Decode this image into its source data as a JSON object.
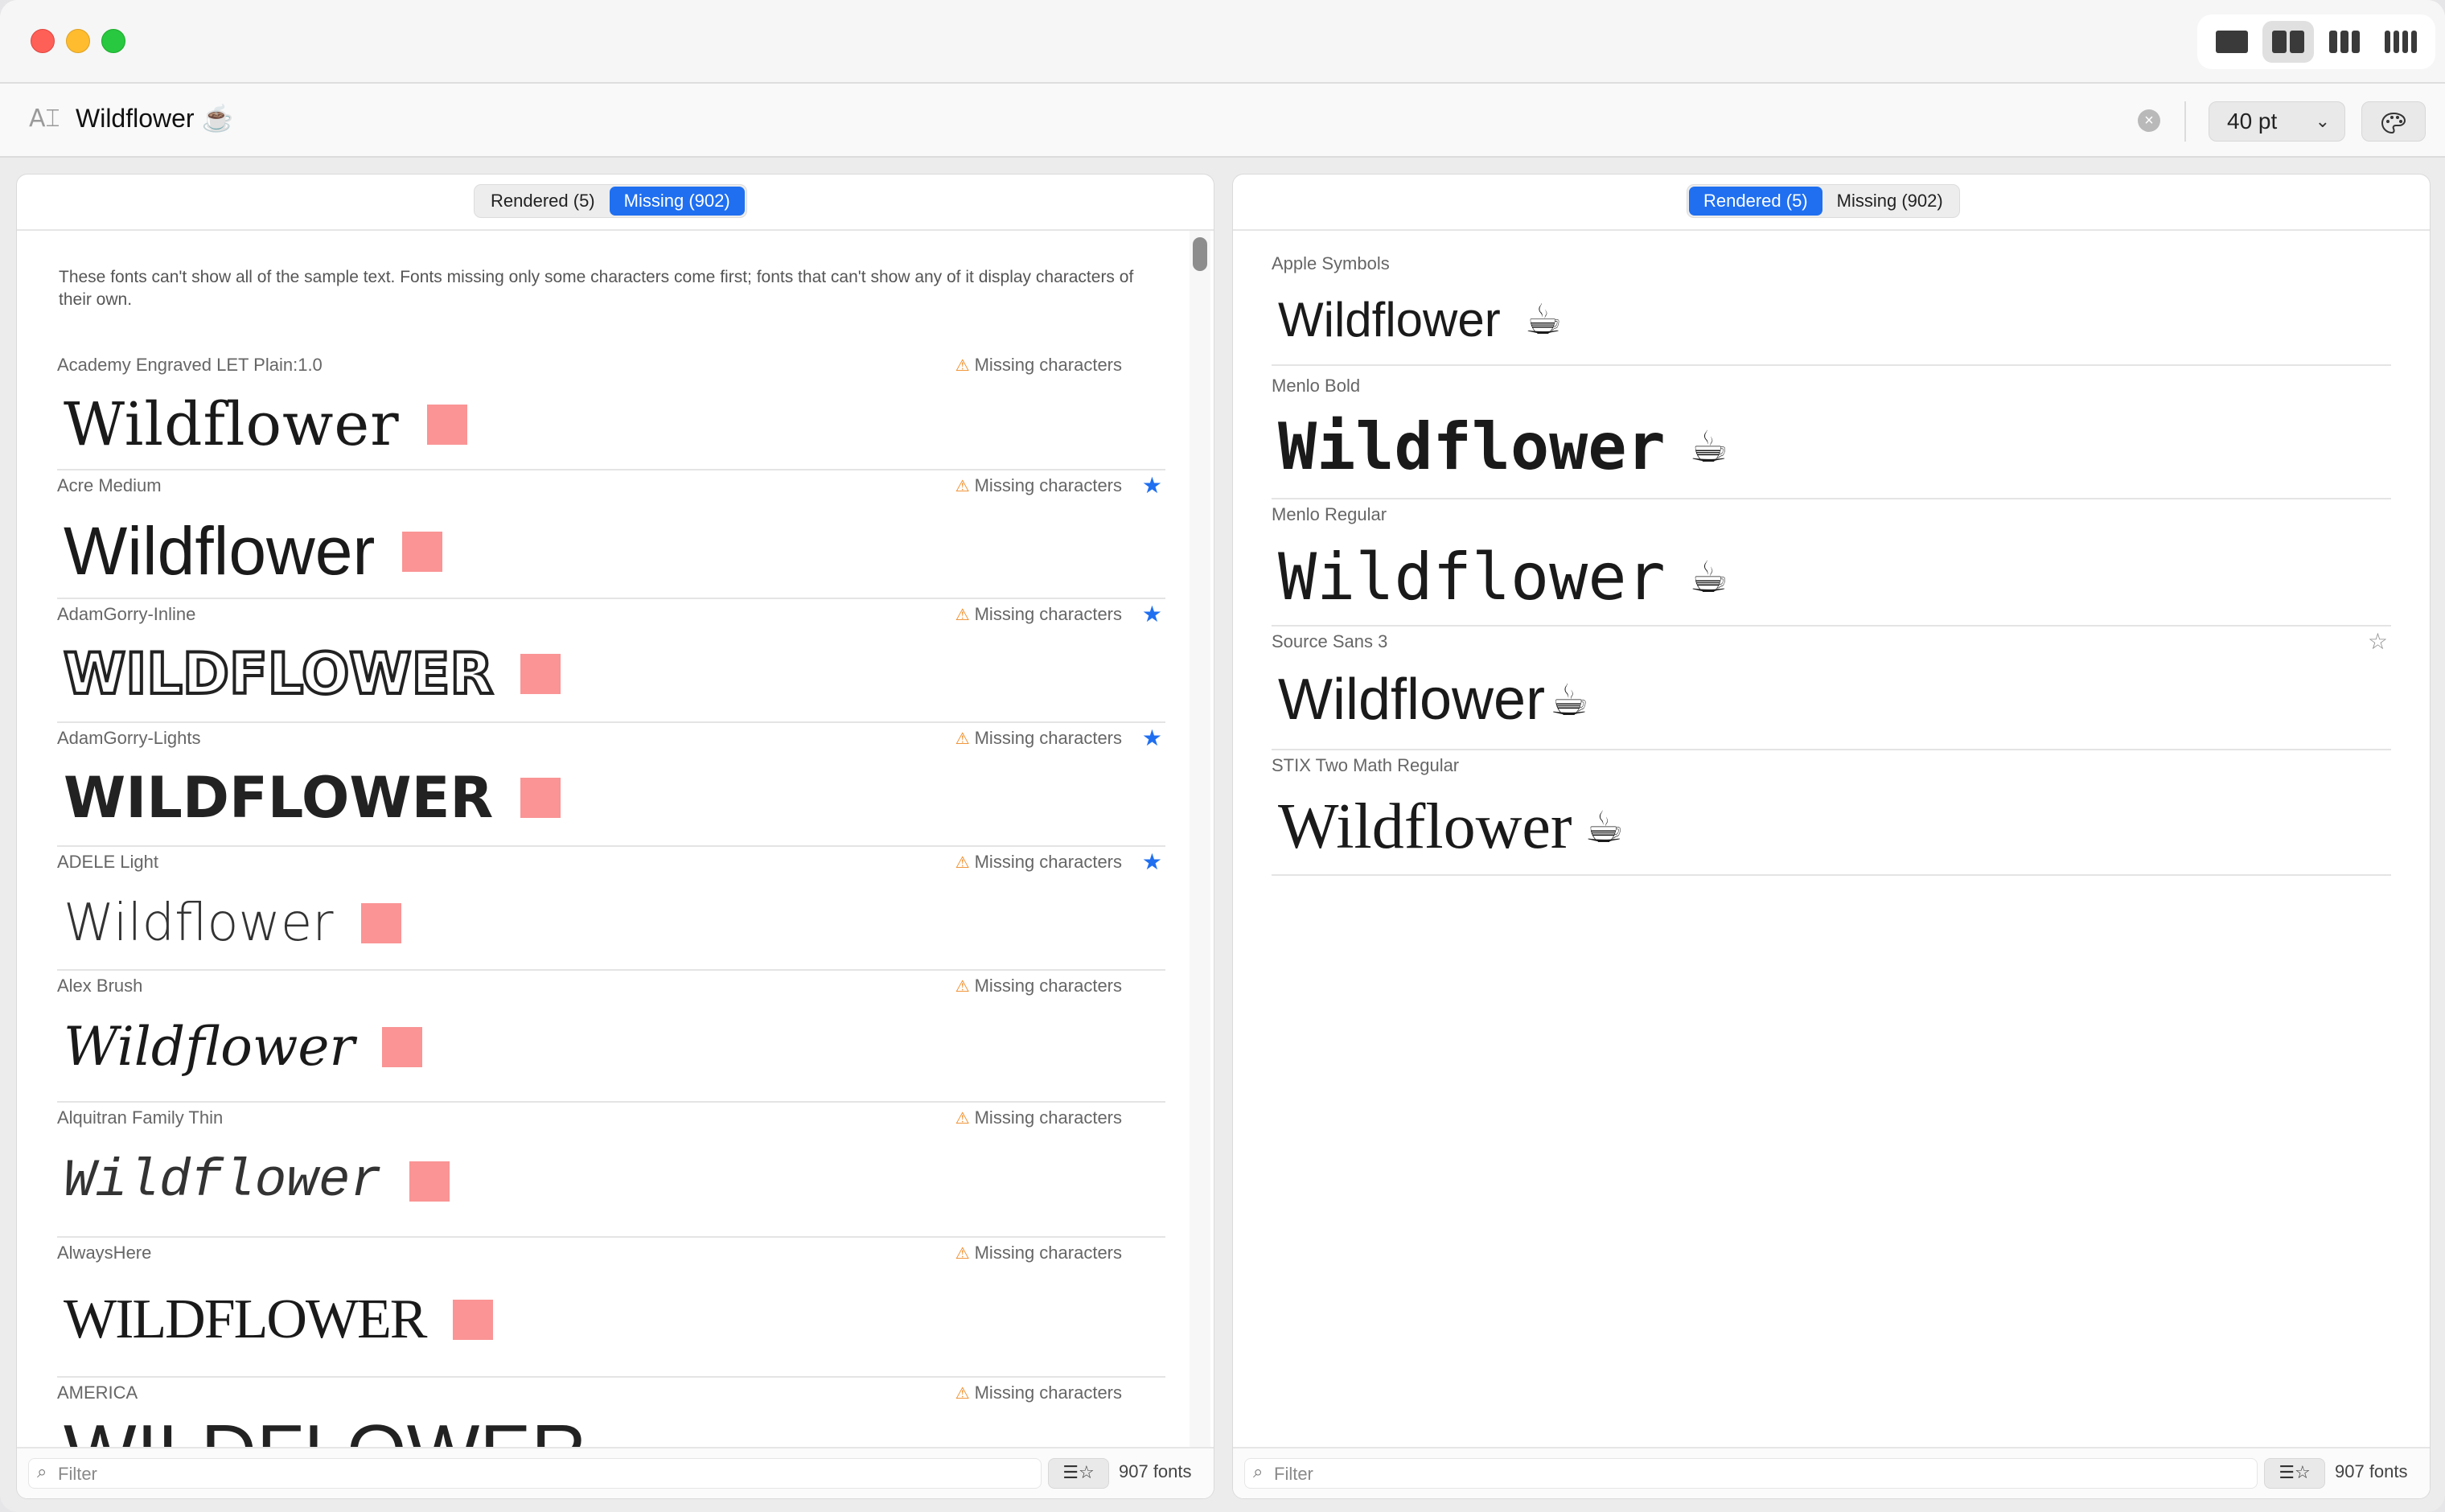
{
  "toolbar": {
    "view_modes": [
      "single-column",
      "two-columns",
      "three-columns",
      "four-columns"
    ],
    "active_view": "two-columns"
  },
  "search": {
    "sample_text": "Wildflower ☕",
    "size_label": "40 pt"
  },
  "left_pane": {
    "tabs": [
      {
        "label": "Rendered (5)",
        "active": false
      },
      {
        "label": "Missing (902)",
        "active": true
      }
    ],
    "notice": "These fonts can't show all of the sample text. Fonts missing only some characters come first; fonts that can't show any of it display characters of their own.",
    "warning_label": "Missing characters",
    "fonts": [
      {
        "name": "Academy Engraved LET Plain:1.0",
        "sample": "Wildflower",
        "starred": false
      },
      {
        "name": "Acre Medium",
        "sample": "Wildflower",
        "starred": true
      },
      {
        "name": "AdamGorry-Inline",
        "sample": "WILDFLOWER",
        "starred": true
      },
      {
        "name": "AdamGorry-Lights",
        "sample": "WILDFLOWER",
        "starred": true
      },
      {
        "name": "ADELE Light",
        "sample": "Wildflower",
        "starred": true
      },
      {
        "name": "Alex Brush",
        "sample": "Wildflower",
        "starred": false
      },
      {
        "name": "Alquitran Family Thin",
        "sample": "Wildflower",
        "starred": false
      },
      {
        "name": "AlwaysHere",
        "sample": "WILDFLOWER",
        "starred": false
      },
      {
        "name": "AMERICA",
        "sample": "WILDFLOWER",
        "starred": false
      }
    ],
    "filter_placeholder": "Filter",
    "count_label": "907 fonts"
  },
  "right_pane": {
    "tabs": [
      {
        "label": "Rendered (5)",
        "active": true
      },
      {
        "label": "Missing (902)",
        "active": false
      }
    ],
    "fonts": [
      {
        "name": "Apple Symbols",
        "sample": "Wildflower",
        "glyph": "☕"
      },
      {
        "name": "Menlo Bold",
        "sample": "Wildflower",
        "glyph": "☕"
      },
      {
        "name": "Menlo Regular",
        "sample": "Wildflower",
        "glyph": "☕"
      },
      {
        "name": "Source Sans 3",
        "sample": "Wildflower",
        "glyph": "☕",
        "starred": false
      },
      {
        "name": "STIX Two Math Regular",
        "sample": "Wildflower",
        "glyph": "☕"
      }
    ],
    "filter_placeholder": "Filter",
    "count_label": "907 fonts"
  },
  "icons": {
    "text_size": "text-cursor-icon",
    "clear": "clear-circle-icon",
    "palette": "palette-icon",
    "warning": "warning-triangle-icon",
    "star": "star-icon",
    "search": "magnifier-icon",
    "sort": "sort-favorites-icon"
  },
  "colors": {
    "accent": "#1f6ff0",
    "missing_box": "#fa9495",
    "warning": "#f08a24"
  }
}
